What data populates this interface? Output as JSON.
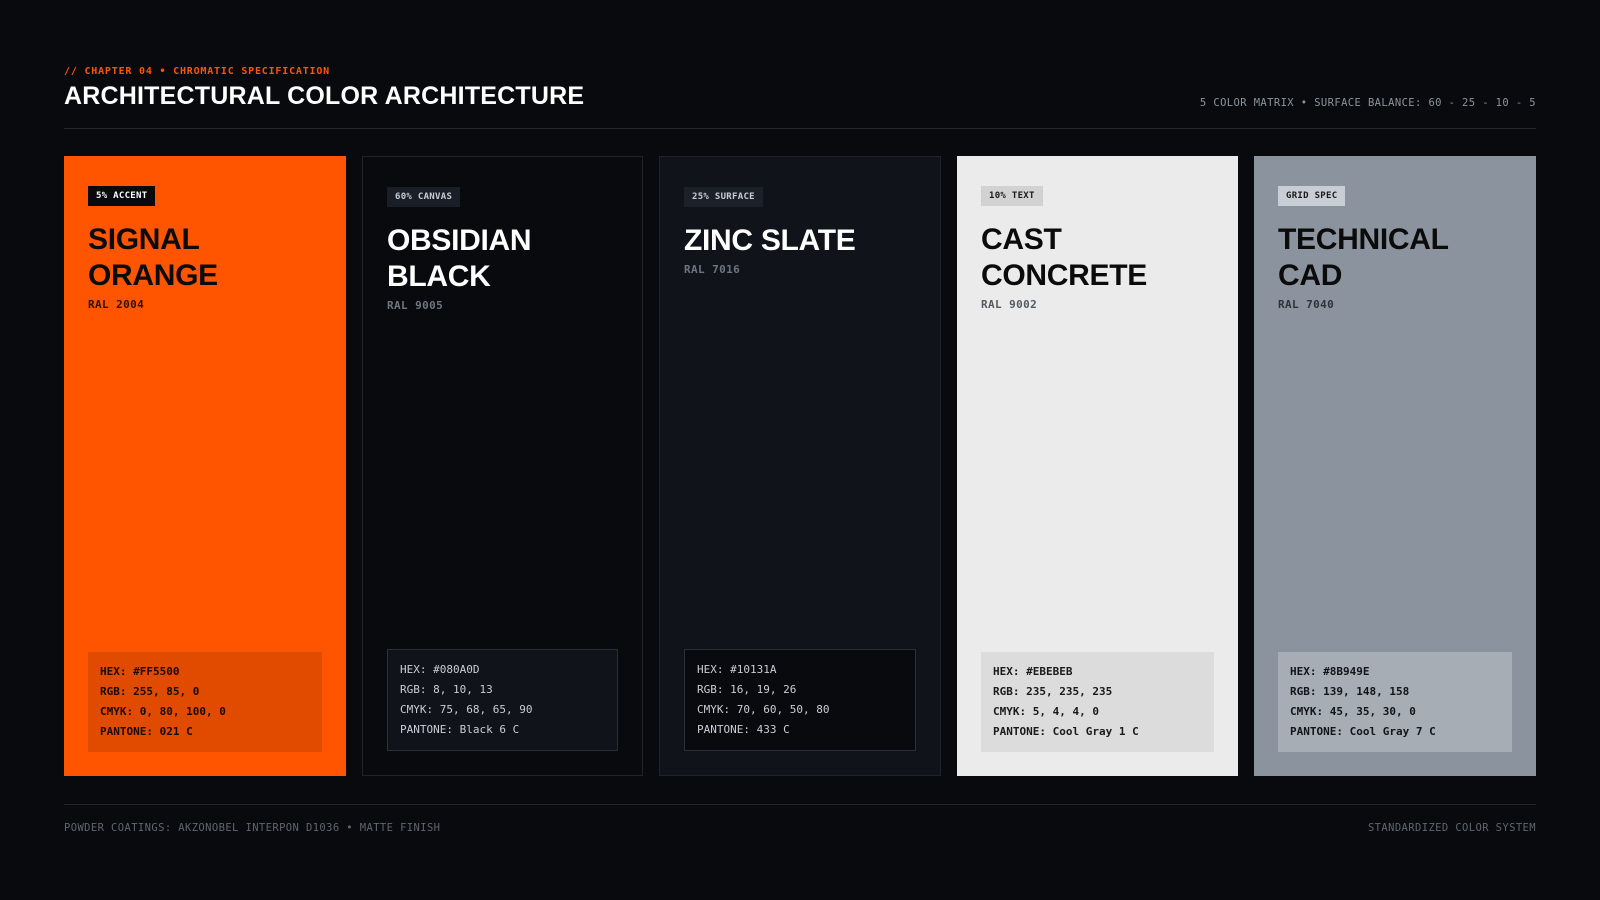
{
  "header": {
    "eyebrow": "// CHAPTER 04 • CHROMATIC SPECIFICATION",
    "title": "ARCHITECTURAL COLOR ARCHITECTURE",
    "meta": "5 COLOR MATRIX • SURFACE BALANCE: 60 - 25 - 10 - 5"
  },
  "cards": [
    {
      "tag": "5% ACCENT",
      "name_line1": "SIGNAL",
      "name_line2": "ORANGE",
      "ral": "RAL 2004",
      "hex": "HEX: #FF5500",
      "rgb": "RGB: 255, 85, 0",
      "cmyk": "CMYK: 0, 80, 100, 0",
      "pantone": "PANTONE: 021 C",
      "color": "#FF5500"
    },
    {
      "tag": "60% CANVAS",
      "name_line1": "OBSIDIAN",
      "name_line2": "BLACK",
      "ral": "RAL 9005",
      "hex": "HEX: #080A0D",
      "rgb": "RGB: 8, 10, 13",
      "cmyk": "CMYK: 75, 68, 65, 90",
      "pantone": "PANTONE: Black 6 C",
      "color": "#080A0D"
    },
    {
      "tag": "25% SURFACE",
      "name_line1": "ZINC SLATE",
      "ral": "RAL 7016",
      "hex": "HEX: #10131A",
      "rgb": "RGB: 16, 19, 26",
      "cmyk": "CMYK: 70, 60, 50, 80",
      "pantone": "PANTONE: 433 C",
      "color": "#10131A"
    },
    {
      "tag": "10% TEXT",
      "name_line1": "CAST",
      "name_line2": "CONCRETE",
      "ral": "RAL 9002",
      "hex": "HEX: #EBEBEB",
      "rgb": "RGB: 235, 235, 235",
      "cmyk": "CMYK: 5, 4, 4, 0",
      "pantone": "PANTONE: Cool Gray 1 C",
      "color": "#EBEBEB"
    },
    {
      "tag": "GRID SPEC",
      "name_line1": "TECHNICAL",
      "name_line2": "CAD",
      "ral": "RAL 7040",
      "hex": "HEX: #8B949E",
      "rgb": "RGB: 139, 148, 158",
      "cmyk": "CMYK: 45, 35, 30, 0",
      "pantone": "PANTONE: Cool Gray 7 C",
      "color": "#8B949E"
    }
  ],
  "footer": {
    "left": "POWDER COATINGS: AKZONOBEL INTERPON D1036 • MATTE FINISH",
    "right": "STANDARDIZED COLOR SYSTEM"
  }
}
